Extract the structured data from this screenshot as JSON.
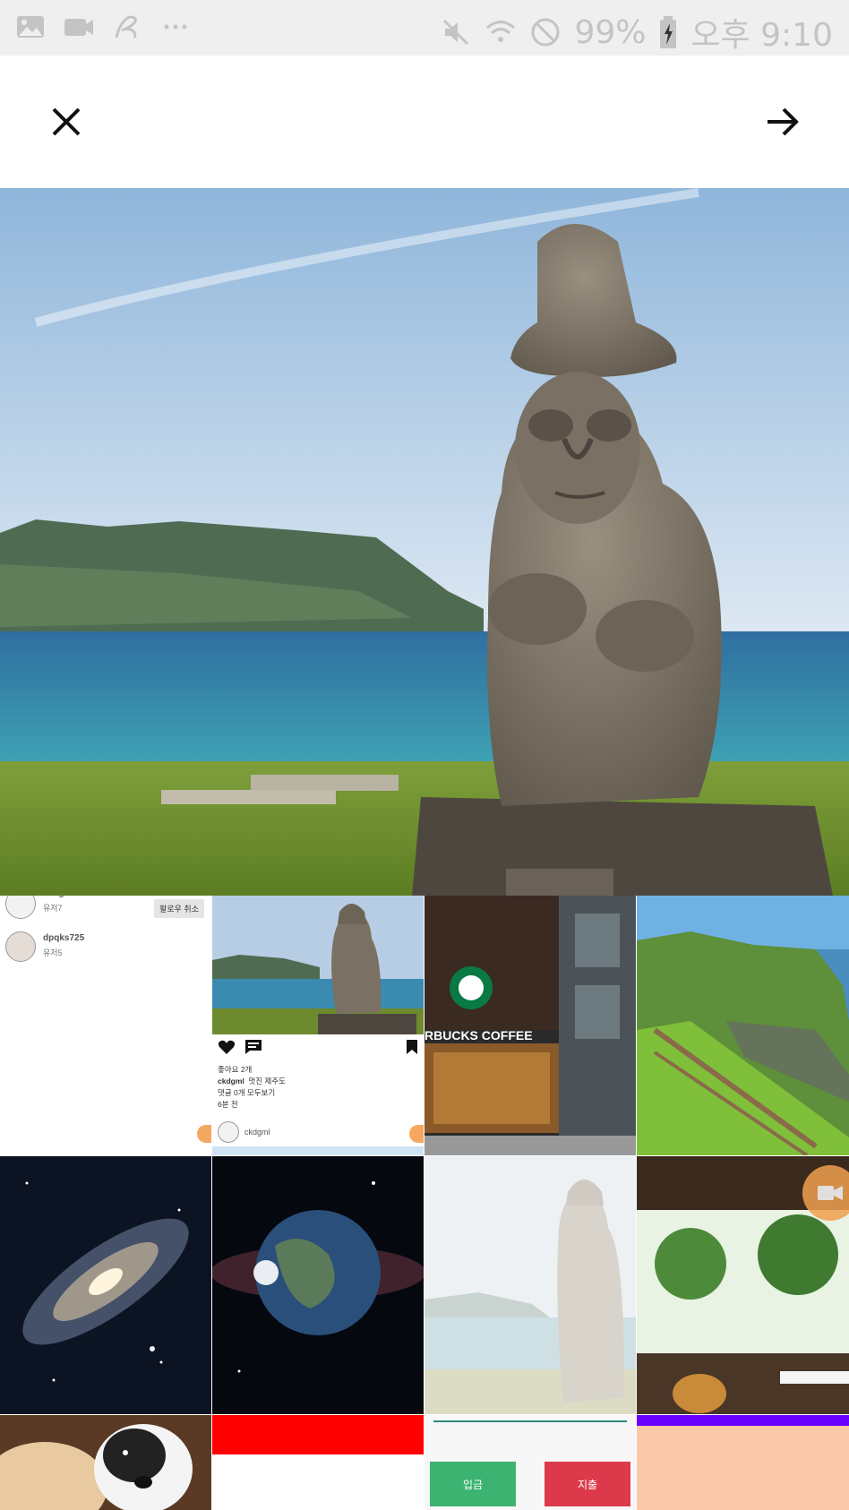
{
  "status_bar": {
    "battery": "99%",
    "time": "오후 9:10"
  },
  "toolbar": {
    "close_icon": "close-icon",
    "next_icon": "arrow-right-icon"
  },
  "grid": {
    "follow_cell": {
      "users": [
        {
          "name": "ckdgml",
          "sub": "유저7"
        },
        {
          "name": "dpqks725",
          "sub": "유저5"
        }
      ],
      "unfollow_label": "팔로우 취소"
    },
    "post_cell": {
      "likes": "좋아요 2개",
      "author": "ckdgml",
      "caption": "멋진 제주도",
      "comments": "댓글 0개 모두보기",
      "time": "6분 전",
      "footer_user": "ckdgml"
    },
    "starbucks_text": "RBUCKS COFFEE",
    "wallet_cell": {
      "deposit_label": "입금",
      "withdraw_label": "지출"
    }
  }
}
